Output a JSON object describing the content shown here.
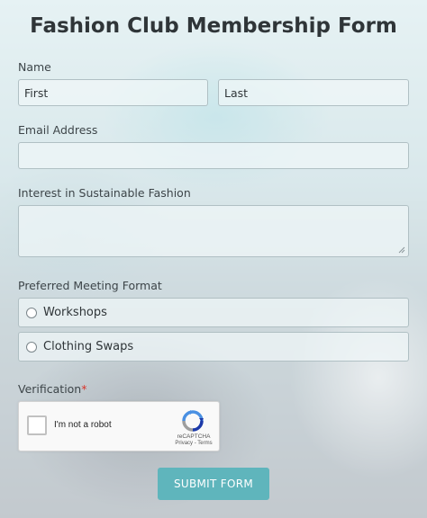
{
  "form": {
    "title": "Fashion Club Membership Form",
    "name_label": "Name",
    "first_placeholder": "First",
    "last_placeholder": "Last",
    "email_label": "Email Address",
    "interest_label": "Interest in Sustainable Fashion",
    "meeting_label": "Preferred Meeting Format",
    "options": [
      "Workshops",
      "Clothing Swaps"
    ],
    "verification_label": "Verification",
    "required_mark": "*",
    "submit_label": "SUBMIT FORM"
  },
  "captcha": {
    "checkbox_label": "I'm not a robot",
    "brand": "reCAPTCHA",
    "links": "Privacy - Terms"
  },
  "colors": {
    "accent": "#5fb5bc",
    "required": "#d9342b"
  }
}
